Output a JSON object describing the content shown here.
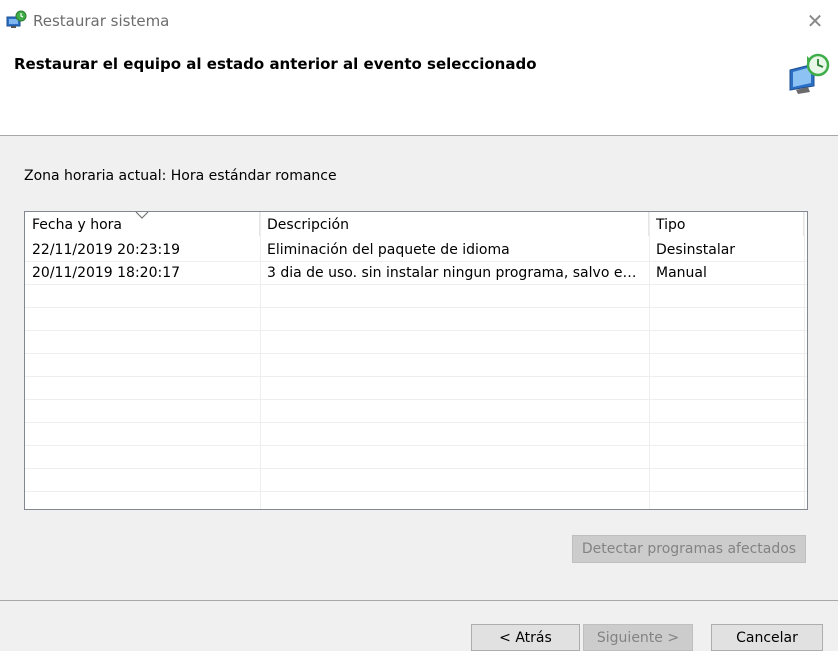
{
  "window": {
    "title": "Restaurar sistema",
    "close_glyph": "✕",
    "icon": "system-restore-icon"
  },
  "header": {
    "heading": "Restaurar el equipo al estado anterior al evento seleccionado",
    "icon": "system-restore-clock-icon"
  },
  "timezone_label": "Zona horaria actual: Hora estándar romance",
  "restore_points": {
    "columns": [
      {
        "label": "Fecha y hora",
        "sorted": true
      },
      {
        "label": "Descripción"
      },
      {
        "label": "Tipo"
      }
    ],
    "rows": [
      {
        "date": "22/11/2019 20:23:19",
        "description": "Eliminación del paquete de idioma",
        "type": "Desinstalar"
      },
      {
        "date": "20/11/2019 18:20:17",
        "description": "3 dia de uso. sin instalar ningun programa, salvo e…",
        "type": "Manual"
      }
    ]
  },
  "buttons": {
    "scan": "Detectar programas afectados",
    "back": "< Atrás",
    "next": "Siguiente >",
    "cancel": "Cancelar"
  },
  "colors": {
    "header_bg": "#ffffff",
    "body_bg": "#f0f0f0",
    "disabled_button_bg": "#cccccc",
    "disabled_text": "#838383"
  }
}
